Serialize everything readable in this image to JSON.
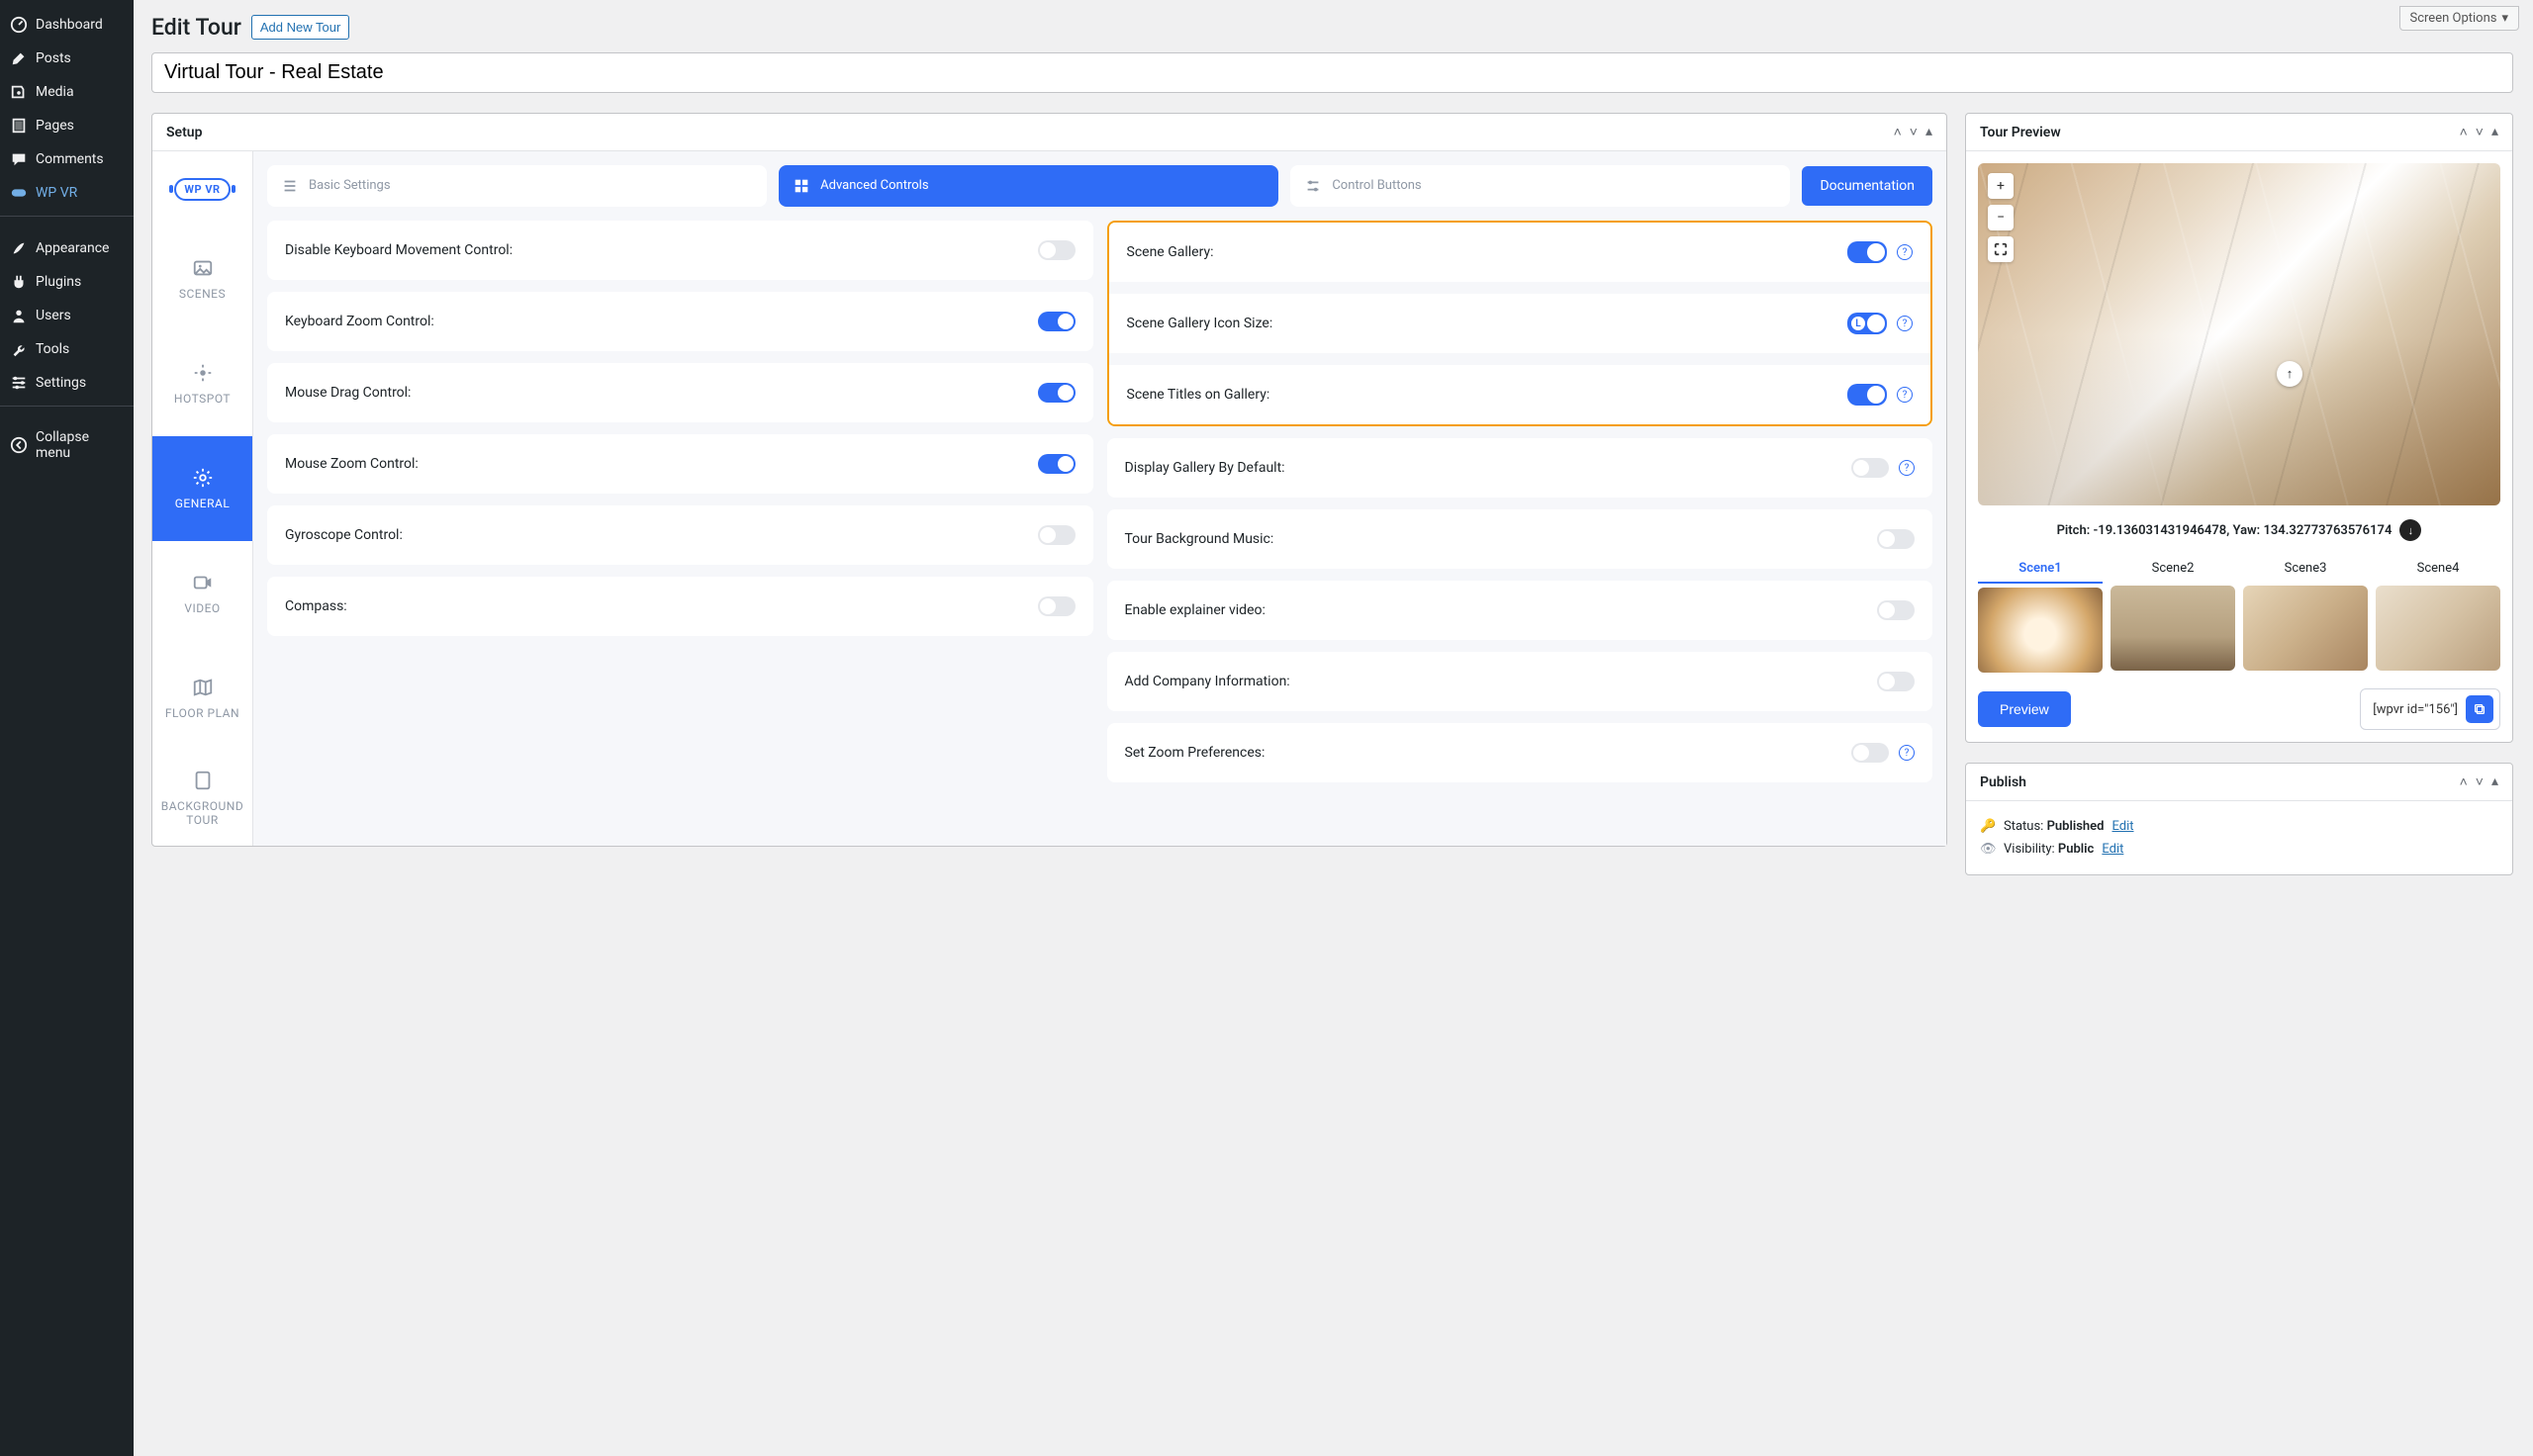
{
  "screen_options": "Screen Options",
  "admin_menu": {
    "items": [
      {
        "icon": "dashboard",
        "label": "Dashboard"
      },
      {
        "icon": "pin",
        "label": "Posts"
      },
      {
        "icon": "media",
        "label": "Media"
      },
      {
        "icon": "page",
        "label": "Pages"
      },
      {
        "icon": "comment",
        "label": "Comments"
      },
      {
        "icon": "wpvr",
        "label": "WP VR"
      }
    ],
    "items2": [
      {
        "icon": "brush",
        "label": "Appearance"
      },
      {
        "icon": "plug",
        "label": "Plugins"
      },
      {
        "icon": "user",
        "label": "Users"
      },
      {
        "icon": "wrench",
        "label": "Tools"
      },
      {
        "icon": "sliders",
        "label": "Settings"
      }
    ],
    "collapse": "Collapse menu"
  },
  "page_title": "Edit Tour",
  "add_new": "Add New Tour",
  "tour_name": "Virtual Tour - Real Estate",
  "setup": {
    "title": "Setup",
    "side_tabs": {
      "scenes": "SCENES",
      "hotspot": "HOTSPOT",
      "general": "GENERAL",
      "video": "VIDEO",
      "floor": "FLOOR PLAN",
      "bg": "BACKGROUND TOUR"
    },
    "top_tabs": {
      "basic": "Basic Settings",
      "advanced": "Advanced Controls",
      "control": "Control Buttons"
    },
    "doc_btn": "Documentation",
    "left": {
      "disable_kb": "Disable Keyboard Movement Control:",
      "kb_zoom": "Keyboard Zoom Control:",
      "drag": "Mouse Drag Control:",
      "m_zoom": "Mouse Zoom Control:",
      "gyro": "Gyroscope Control:",
      "compass": "Compass:"
    },
    "right": {
      "gallery": "Scene Gallery:",
      "icon_size": "Scene Gallery Icon Size:",
      "titles": "Scene Titles on Gallery:",
      "display_default": "Display Gallery By Default:",
      "music": "Tour Background Music:",
      "explainer": "Enable explainer video:",
      "company": "Add Company Information:",
      "zoom_pref": "Set Zoom Preferences:"
    },
    "toggles": {
      "disable_kb": false,
      "kb_zoom": true,
      "drag": true,
      "m_zoom": true,
      "gyro": false,
      "compass": false,
      "gallery": true,
      "icon_size": true,
      "titles": true,
      "display_default": false,
      "music": false,
      "explainer": false,
      "company": false,
      "zoom_pref": false
    },
    "icon_size_badge": "L"
  },
  "preview": {
    "title": "Tour Preview",
    "pitch_label": "Pitch:",
    "pitch_val": "-19.136031431946478",
    "yaw_label": "Yaw:",
    "yaw_val": "134.32773763576174",
    "scenes": [
      "Scene1",
      "Scene2",
      "Scene3",
      "Scene4"
    ],
    "active_scene": 0,
    "preview_btn": "Preview",
    "shortcode": "[wpvr id=\"156\"]"
  },
  "publish": {
    "title": "Publish",
    "status_label": "Status:",
    "status_val": "Published",
    "edit": "Edit",
    "vis_label": "Visibility:",
    "vis_val": "Public"
  }
}
